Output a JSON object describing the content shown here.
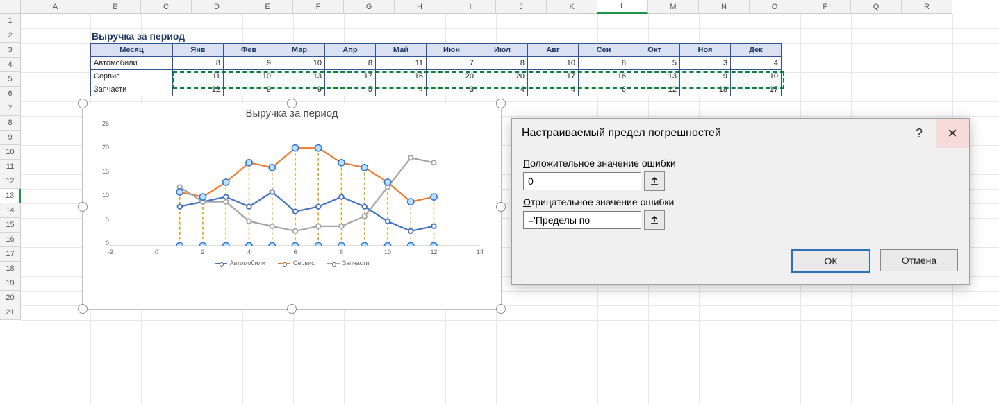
{
  "columns": [
    "A",
    "B",
    "C",
    "D",
    "E",
    "F",
    "G",
    "H",
    "I",
    "J",
    "K",
    "L",
    "M",
    "N",
    "O",
    "P",
    "Q",
    "R"
  ],
  "active_col": "L",
  "rows": [
    1,
    2,
    3,
    4,
    5,
    6,
    7,
    8,
    9,
    10,
    11,
    12,
    13,
    14,
    15,
    16,
    17,
    18,
    19,
    20,
    21
  ],
  "active_row": 13,
  "table": {
    "title": "Выручка за период",
    "header": [
      "Месяц",
      "Янв",
      "Фев",
      "Мар",
      "Апр",
      "Май",
      "Июн",
      "Июл",
      "Авг",
      "Сен",
      "Окт",
      "Ноя",
      "Дек"
    ],
    "rows": [
      {
        "name": "Автомобили",
        "values": [
          8,
          9,
          10,
          8,
          11,
          7,
          8,
          10,
          8,
          5,
          3,
          4
        ]
      },
      {
        "name": "Сервис",
        "values": [
          11,
          10,
          13,
          17,
          16,
          20,
          20,
          17,
          16,
          13,
          9,
          10
        ]
      },
      {
        "name": "Запчасти",
        "values": [
          12,
          9,
          9,
          5,
          4,
          3,
          4,
          4,
          6,
          12,
          18,
          17
        ]
      }
    ]
  },
  "chart_data": {
    "type": "line",
    "title": "Выручка за период",
    "xlabel": "",
    "ylabel": "",
    "x": [
      1,
      2,
      3,
      4,
      5,
      6,
      7,
      8,
      9,
      10,
      11,
      12
    ],
    "xlim": [
      -2,
      14
    ],
    "ylim": [
      0,
      25
    ],
    "yticks": [
      0,
      5,
      10,
      15,
      20,
      25
    ],
    "xticks": [
      -2,
      0,
      2,
      4,
      6,
      8,
      10,
      12,
      14
    ],
    "series": [
      {
        "name": "Автомобили",
        "color": "#4472C4",
        "values": [
          8,
          9,
          10,
          8,
          11,
          7,
          8,
          10,
          8,
          5,
          3,
          4
        ]
      },
      {
        "name": "Сервис",
        "color": "#ED7D31",
        "values": [
          11,
          10,
          13,
          17,
          16,
          20,
          20,
          17,
          16,
          13,
          9,
          10
        ]
      },
      {
        "name": "Запчасти",
        "color": "#A5A5A5",
        "values": [
          12,
          9,
          9,
          5,
          4,
          3,
          4,
          4,
          6,
          12,
          18,
          17
        ]
      }
    ],
    "error_bar_markers_series": "Сервис"
  },
  "dialog": {
    "title": "Настраиваемый предел погрешностей",
    "help": "?",
    "close": "✕",
    "pos_label_u": "П",
    "pos_label_rest": "оложительное значение ошибки",
    "pos_value": "0",
    "neg_label_u": "О",
    "neg_label_rest": "трицательное значение ошибки",
    "neg_value": "='Пределы по",
    "ok": "ОК",
    "cancel": "Отмена"
  }
}
